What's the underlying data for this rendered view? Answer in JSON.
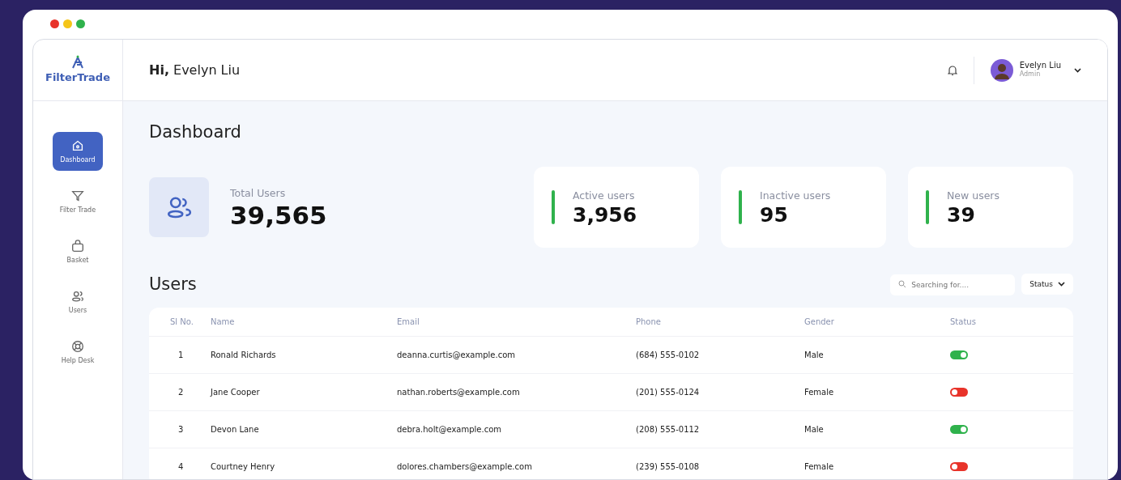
{
  "brand": {
    "name": "FilterTrade"
  },
  "sidebar": {
    "items": [
      {
        "label": "Dashboard",
        "selected": true
      },
      {
        "label": "Filter Trade",
        "selected": false
      },
      {
        "label": "Basket",
        "selected": false
      },
      {
        "label": "Users",
        "selected": false
      },
      {
        "label": "Help Desk",
        "selected": false
      }
    ]
  },
  "header": {
    "greeting": "**Hi,** Evelyn Liu",
    "user": {
      "name": "Evelyn Liu",
      "role": "Admin"
    }
  },
  "page_title": "Dashboard",
  "total": {
    "label": "Total Users",
    "value": "39,565"
  },
  "stats": [
    {
      "label": "Active users",
      "value": "3,956"
    },
    {
      "label": "Inactive users",
      "value": "95"
    },
    {
      "label": "New users",
      "value": "39"
    }
  ],
  "users_title": "Users",
  "search": {
    "placeholder": "Searching for...."
  },
  "filter": {
    "label": "Status"
  },
  "table": {
    "columns": [
      "Sl No.",
      "Name",
      "Email",
      "Phone",
      "Gender",
      "Status"
    ],
    "rows": [
      {
        "no": "1",
        "name": "Ronald Richards",
        "email": "deanna.curtis@example.com",
        "phone": "(684) 555-0102",
        "gender": "Male",
        "on": true
      },
      {
        "no": "2",
        "name": "Jane Cooper",
        "email": "nathan.roberts@example.com",
        "phone": "(201) 555-0124",
        "gender": "Female",
        "on": false
      },
      {
        "no": "3",
        "name": "Devon Lane",
        "email": "debra.holt@example.com",
        "phone": "(208) 555-0112",
        "gender": "Male",
        "on": true
      },
      {
        "no": "4",
        "name": "Courtney Henry",
        "email": "dolores.chambers@example.com",
        "phone": "(239) 555-0108",
        "gender": "Female",
        "on": false
      }
    ]
  }
}
